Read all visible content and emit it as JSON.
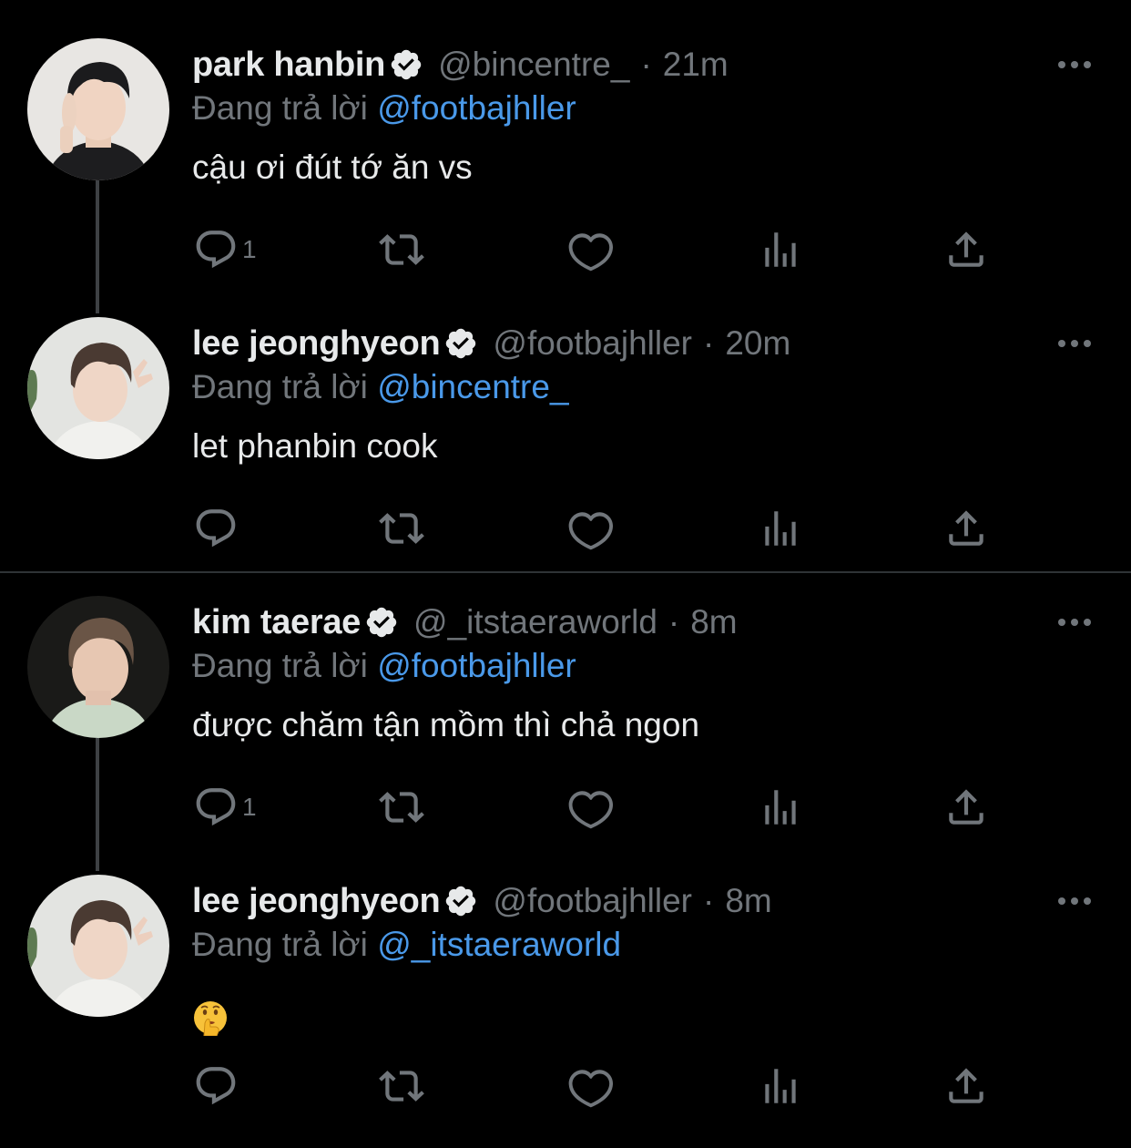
{
  "reply_prefix": "Đang trả lời",
  "tweets": [
    {
      "name": "park hanbin",
      "handle": "@bincentre_",
      "separator": "·",
      "time": "21m",
      "replying_to": "@footbajhller",
      "text": "cậu ơi đút tớ ăn vs",
      "reply_count": "1"
    },
    {
      "name": "lee jeonghyeon",
      "handle": "@footbajhller",
      "separator": "·",
      "time": "20m",
      "replying_to": "@bincentre_",
      "text": "let phanbin cook",
      "reply_count": ""
    },
    {
      "name": "kim taerae",
      "handle": "@_itstaeraworld",
      "separator": "·",
      "time": "8m",
      "replying_to": "@footbajhller",
      "text": "được chăm tận mồm thì chả ngon",
      "reply_count": "1"
    },
    {
      "name": "lee jeonghyeon",
      "handle": "@footbajhller",
      "separator": "·",
      "time": "8m",
      "replying_to": "@_itstaeraworld",
      "text": "",
      "emoji": "shushing-face",
      "reply_count": ""
    }
  ],
  "colors": {
    "background": "#000000",
    "text_primary": "#e7e9ea",
    "text_secondary": "#71767b",
    "link": "#4a99e9",
    "verified": "#e7e9ea"
  }
}
